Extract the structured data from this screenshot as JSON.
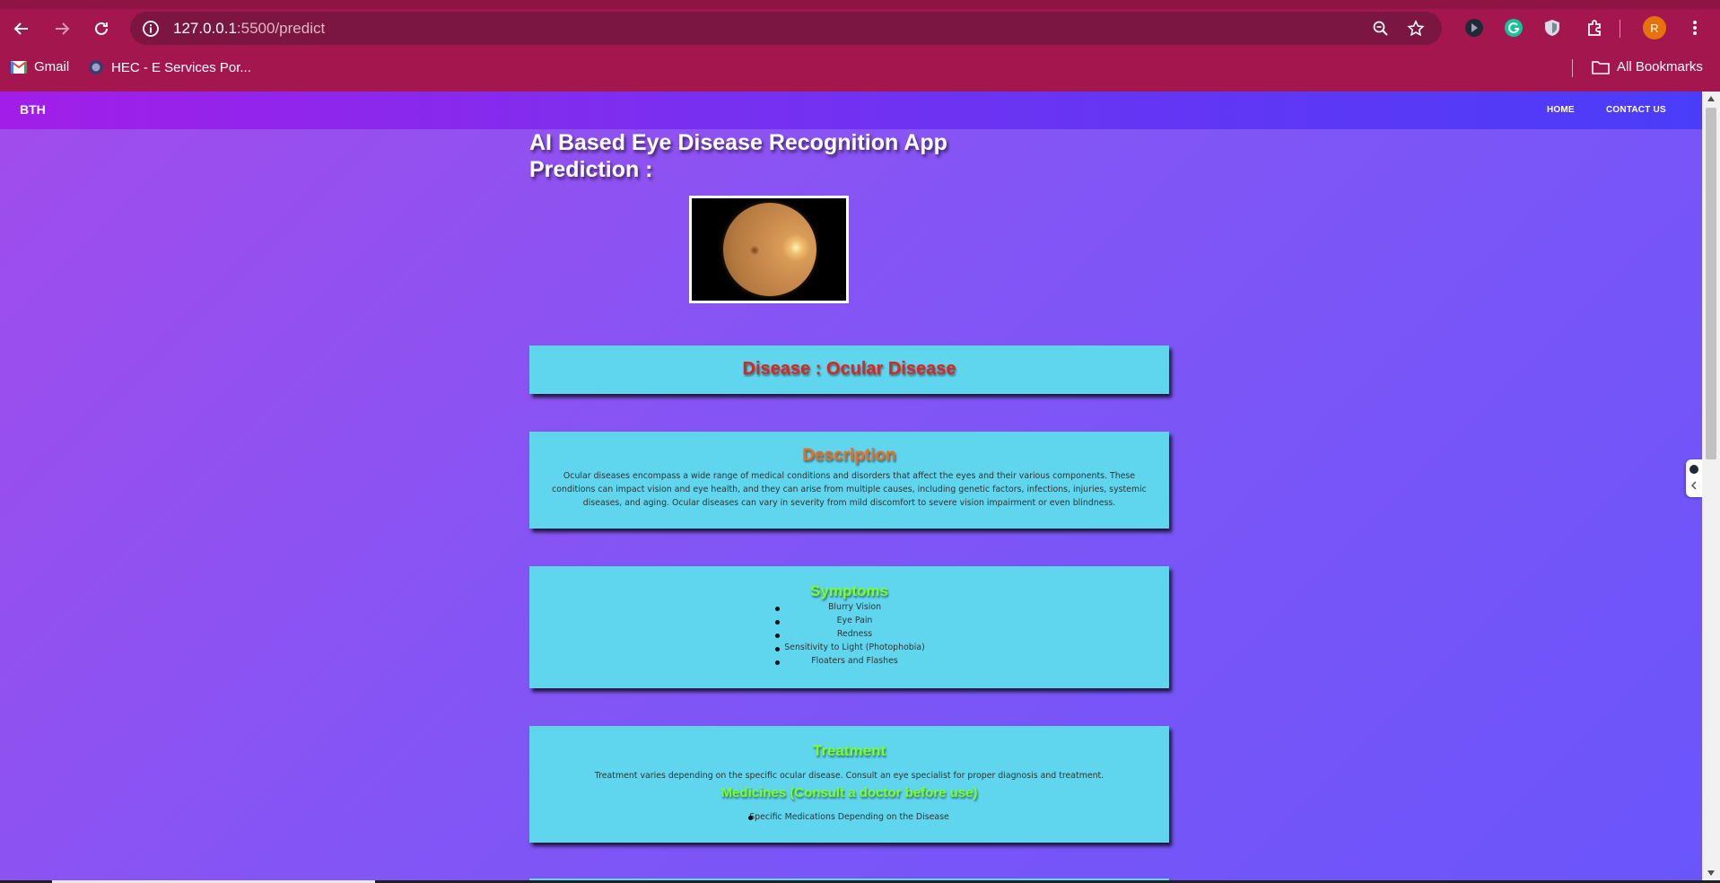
{
  "browser": {
    "url_host": "127.0.0.1",
    "url_path": ":5500/predict",
    "avatar_letter": "R",
    "bookmarks": [
      {
        "label": "Gmail",
        "icon": "gmail-icon"
      },
      {
        "label": "HEC - E Services Por...",
        "icon": "hec-icon"
      }
    ],
    "all_bookmarks_label": "All Bookmarks"
  },
  "navbar": {
    "brand": "BTH",
    "links": [
      "HOME",
      "CONTACT US"
    ]
  },
  "page": {
    "title_line1": "AI Based Eye Disease Recognition App",
    "title_line2": "Prediction :"
  },
  "result": {
    "disease": "Disease : Ocular Disease",
    "description_heading": "Description",
    "description": "Ocular diseases encompass a wide range of medical conditions and disorders that affect the eyes and their various components. These conditions can impact vision and eye health, and they can arise from multiple causes, including genetic factors, infections, injuries, systemic diseases, and aging. Ocular diseases can vary in severity from mild discomfort to severe vision impairment or even blindness.",
    "symptoms_heading": "Symptoms",
    "symptoms": [
      "Blurry Vision",
      "Eye Pain",
      "Redness",
      "Sensitivity to Light (Photophobia)",
      "Floaters and Flashes"
    ],
    "treatment_heading": "Treatment",
    "treatment": "Treatment varies depending on the specific ocular disease. Consult an eye specialist for proper diagnosis and treatment.",
    "medicines_heading": "Medicines (Consult a doctor before use)",
    "medicines": [
      "Specific Medications Depending on the Disease"
    ]
  },
  "colors": {
    "chrome": "#a4174e",
    "card": "#5fd6ee",
    "disease_text": "#e1221d",
    "description_heading": "#f26a1b",
    "green_heading": "#7cff27"
  }
}
